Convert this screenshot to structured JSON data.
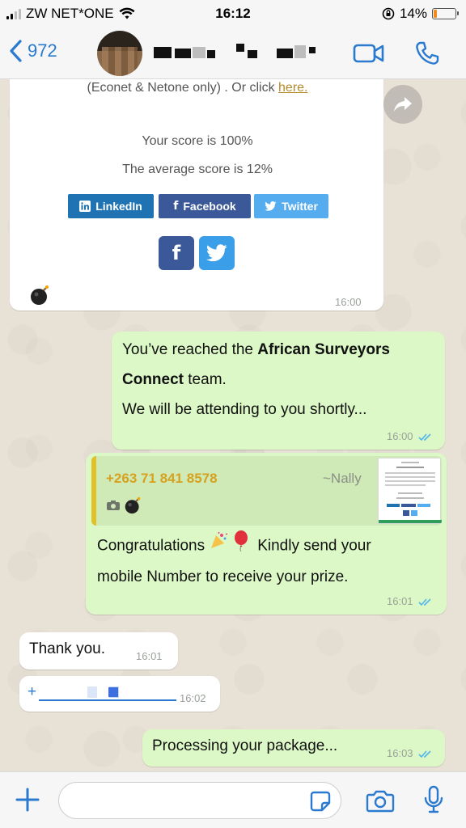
{
  "status_bar": {
    "carrier": "ZW NET*ONE",
    "time": "16:12",
    "battery": "14%",
    "battery_level": 0.14
  },
  "header": {
    "back_label": "972",
    "icons": [
      "chevron-left-icon",
      "video-call-icon",
      "phone-icon"
    ]
  },
  "colors": {
    "accent": "#2a7ad0",
    "outgoing_bubble": "#dcf8c6",
    "incoming_bubble": "#ffffff",
    "quote_bar": "#e1c02a",
    "linkedin": "#1f73b3",
    "facebook": "#3b5998",
    "twitter": "#55acee"
  },
  "messages": {
    "card": {
      "partial_line": "(Econet & Netone only) . Or click",
      "link": "here.",
      "score": "Your score is 100%",
      "average": "The average score is 12%",
      "share_linkedin": "LinkedIn",
      "share_facebook": "Facebook",
      "share_twitter": "Twitter",
      "time": "16:00"
    },
    "m1": {
      "part1": "You’ve reached the ",
      "bold": "African Surveyors",
      "bold2": "Connect",
      "part2": " team.",
      "line3": "We will be attending to you shortly...",
      "time": "16:00"
    },
    "m2": {
      "quote_number": "+263 71 841 8578",
      "quote_alias": "~Nally",
      "line1_a": "Congratulations",
      "line1_b": "Kindly send your",
      "line2": "mobile Number to receive your prize.",
      "time": "16:01"
    },
    "m3": {
      "text": "Thank you.",
      "time": "16:01"
    },
    "m4": {
      "prefix": "+",
      "time": "16:02"
    },
    "m5": {
      "text": "Processing your package...",
      "time": "16:03"
    }
  }
}
